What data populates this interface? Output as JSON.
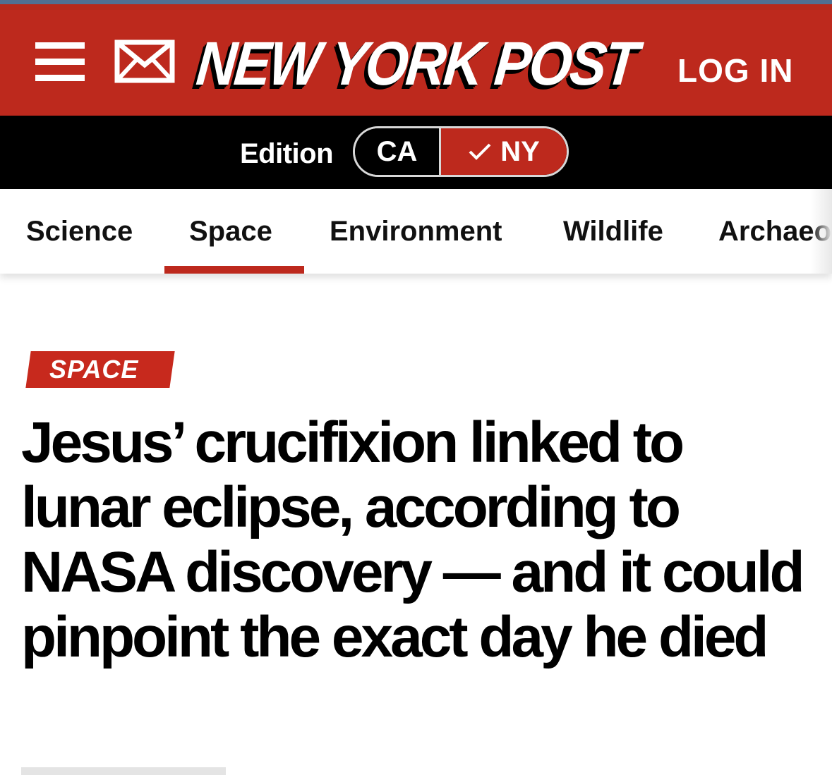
{
  "masthead": {
    "logo_text": "NEW YORK POST",
    "login_label": "LOG IN",
    "menu_icon": "hamburger-menu-icon",
    "mail_icon": "envelope-icon",
    "brand_color": "#bd291d"
  },
  "edition": {
    "label": "Edition",
    "options": [
      "CA",
      "NY"
    ],
    "selected": "NY"
  },
  "nav": {
    "items": [
      "Science",
      "Space",
      "Environment",
      "Wildlife",
      "Archaeo"
    ],
    "active": "Space"
  },
  "article": {
    "section_tag": "SPACE",
    "headline": "Jesus’ crucifixion linked to lunar eclipse, according to NASA discovery — and it could pinpoint the exact day he died"
  }
}
